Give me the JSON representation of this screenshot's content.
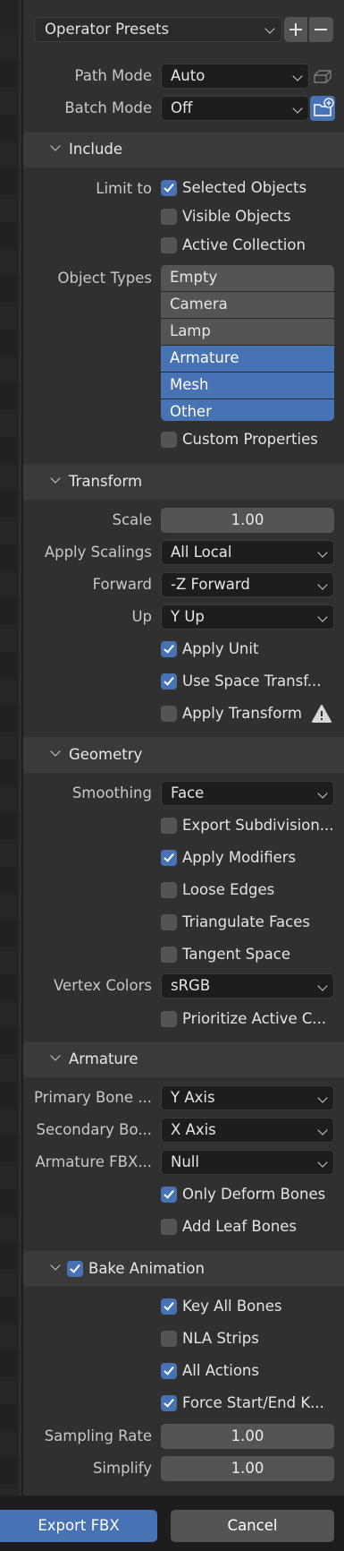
{
  "presets": {
    "label": "Operator Presets"
  },
  "path_mode": {
    "label": "Path Mode",
    "value": "Auto"
  },
  "batch_mode": {
    "label": "Batch Mode",
    "value": "Off"
  },
  "include": {
    "title": "Include",
    "limit_to_label": "Limit to",
    "selected_objects": "Selected Objects",
    "visible_objects": "Visible Objects",
    "active_collection": "Active Collection",
    "object_types_label": "Object Types",
    "object_types": [
      {
        "label": "Empty",
        "selected": false
      },
      {
        "label": "Camera",
        "selected": false
      },
      {
        "label": "Lamp",
        "selected": false
      },
      {
        "label": "Armature",
        "selected": true
      },
      {
        "label": "Mesh",
        "selected": true
      },
      {
        "label": "Other",
        "selected": true
      }
    ],
    "custom_properties": "Custom Properties"
  },
  "transform": {
    "title": "Transform",
    "scale_label": "Scale",
    "scale_value": "1.00",
    "apply_scalings_label": "Apply Scalings",
    "apply_scalings_value": "All Local",
    "forward_label": "Forward",
    "forward_value": "-Z Forward",
    "up_label": "Up",
    "up_value": "Y Up",
    "apply_unit": "Apply Unit",
    "use_space_transform": "Use Space Transf...",
    "apply_transform": "Apply Transform"
  },
  "geometry": {
    "title": "Geometry",
    "smoothing_label": "Smoothing",
    "smoothing_value": "Face",
    "export_subdivision": "Export Subdivision...",
    "apply_modifiers": "Apply Modifiers",
    "loose_edges": "Loose Edges",
    "triangulate_faces": "Triangulate Faces",
    "tangent_space": "Tangent Space",
    "vertex_colors_label": "Vertex Colors",
    "vertex_colors_value": "sRGB",
    "prioritize_active": "Prioritize Active C..."
  },
  "armature": {
    "title": "Armature",
    "primary_bone_label": "Primary Bone ...",
    "primary_bone_value": "Y Axis",
    "secondary_bone_label": "Secondary Bo...",
    "secondary_bone_value": "X Axis",
    "armature_fbx_label": "Armature FBX...",
    "armature_fbx_value": "Null",
    "only_deform_bones": "Only Deform Bones",
    "add_leaf_bones": "Add Leaf Bones"
  },
  "bake": {
    "title": "Bake Animation",
    "key_all_bones": "Key All Bones",
    "nla_strips": "NLA Strips",
    "all_actions": "All Actions",
    "force_start_end": "Force Start/End K...",
    "sampling_rate_label": "Sampling Rate",
    "sampling_rate_value": "1.00",
    "simplify_label": "Simplify",
    "simplify_value": "1.00"
  },
  "footer": {
    "export_label": "Export FBX",
    "cancel_label": "Cancel"
  },
  "colors": {
    "accent": "#4772b3",
    "panel": "#303030",
    "header": "#3a3a3a",
    "field": "#1d1d1d"
  }
}
